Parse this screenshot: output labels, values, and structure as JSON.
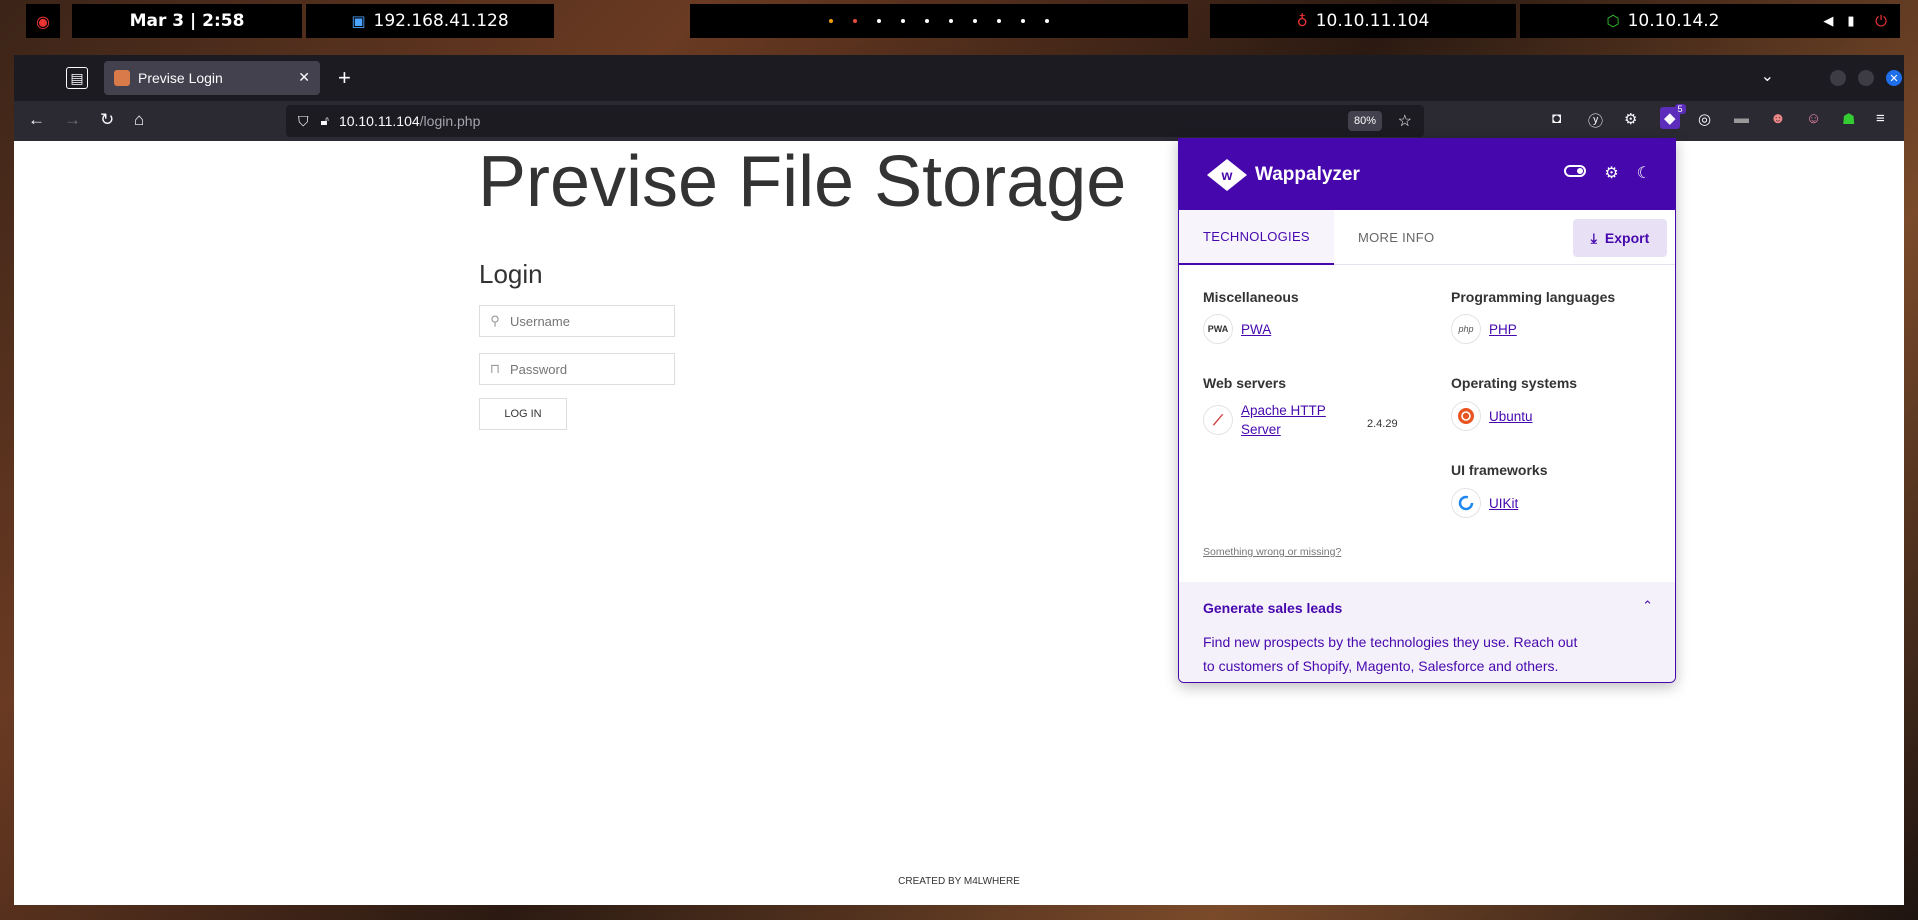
{
  "sysbar": {
    "datetime": "Mar 3 | 2:58",
    "local_ip": "192.168.41.128",
    "target_ip": "10.10.11.104",
    "vpn_ip": "10.10.14.2"
  },
  "browser": {
    "tab_title": "Previse Login",
    "url_host": "10.10.11.104",
    "url_path": "/login.php",
    "zoom": "80%",
    "ext_badge": "5"
  },
  "page": {
    "title": "Previse File Storage",
    "login_heading": "Login",
    "username_placeholder": "Username",
    "password_placeholder": "Password",
    "login_button": "LOG IN",
    "footer": "CREATED BY M4LWHERE"
  },
  "wappalyzer": {
    "brand": "Wappalyzer",
    "tab_technologies": "TECHNOLOGIES",
    "tab_more_info": "MORE INFO",
    "export_label": "Export",
    "categories": {
      "misc": {
        "title": "Miscellaneous",
        "tech": "PWA",
        "icon_text": "PWA"
      },
      "web_servers": {
        "title": "Web servers",
        "tech_line1": "Apache HTTP",
        "tech_line2": "Server",
        "version": "2.4.29"
      },
      "prog_lang": {
        "title": "Programming languages",
        "tech": "PHP",
        "icon_text": "php"
      },
      "os": {
        "title": "Operating systems",
        "tech": "Ubuntu"
      },
      "ui": {
        "title": "UI frameworks",
        "tech": "UIKit"
      }
    },
    "something_wrong": "Something wrong or missing?",
    "leads_title": "Generate sales leads",
    "leads_line1": "Find new prospects by the technologies they use. Reach out",
    "leads_line2": "to customers of Shopify, Magento, Salesforce and others."
  },
  "colors": {
    "wappalyzer_purple": "#4608ad",
    "browser_chrome": "#2b2a33",
    "tabstrip": "#1c1b22"
  }
}
